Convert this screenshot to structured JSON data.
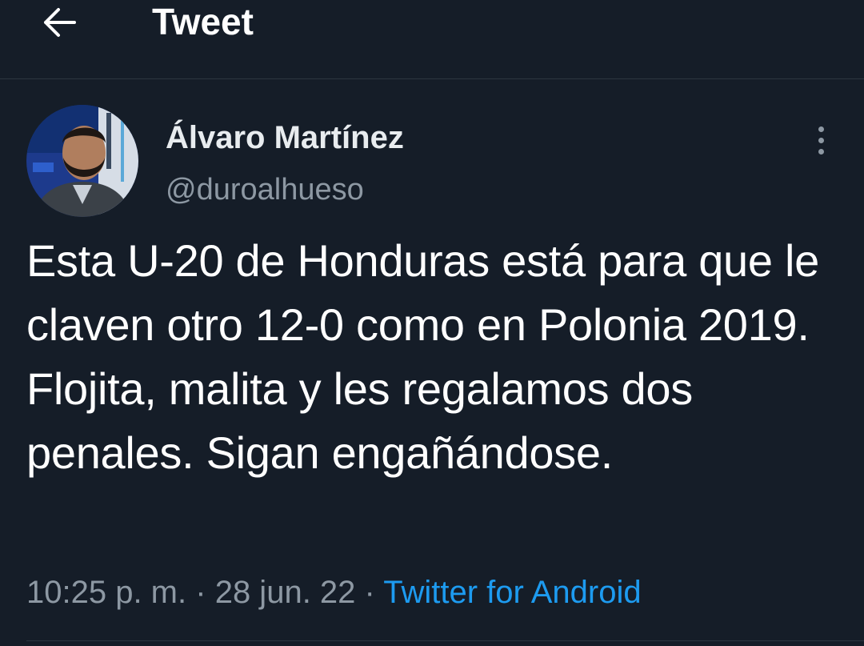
{
  "header": {
    "back_icon": "arrow-left-icon",
    "title": "Tweet"
  },
  "tweet": {
    "author_name": "Álvaro Martínez",
    "author_handle": "@duroalhueso",
    "more_icon": "more-vertical-icon",
    "text": "Esta U-20 de Honduras está para que le claven otro 12-0 como en Polonia 2019. Flojita, malita y les regalamos dos penales. Sigan engañándose.",
    "time": "10:25 p. m.",
    "separator": "·",
    "date": "28 jun. 22",
    "source": "Twitter for Android"
  },
  "colors": {
    "background": "#151d28",
    "text": "#ffffff",
    "secondary": "#8d98a3",
    "link": "#1d9bf0",
    "divider": "#2c3640"
  }
}
